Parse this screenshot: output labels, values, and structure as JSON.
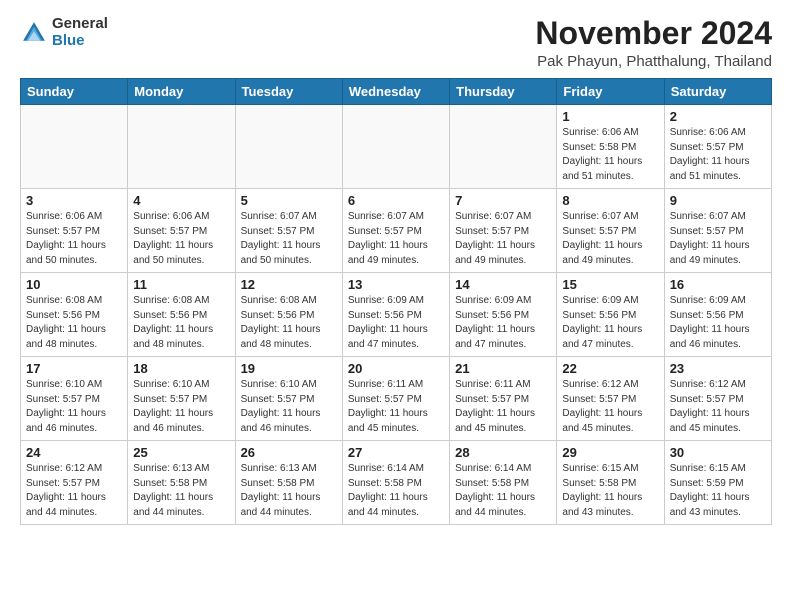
{
  "logo": {
    "general": "General",
    "blue": "Blue"
  },
  "title": "November 2024",
  "location": "Pak Phayun, Phatthalung, Thailand",
  "weekdays": [
    "Sunday",
    "Monday",
    "Tuesday",
    "Wednesday",
    "Thursday",
    "Friday",
    "Saturday"
  ],
  "weeks": [
    [
      {
        "day": "",
        "info": ""
      },
      {
        "day": "",
        "info": ""
      },
      {
        "day": "",
        "info": ""
      },
      {
        "day": "",
        "info": ""
      },
      {
        "day": "",
        "info": ""
      },
      {
        "day": "1",
        "info": "Sunrise: 6:06 AM\nSunset: 5:58 PM\nDaylight: 11 hours\nand 51 minutes."
      },
      {
        "day": "2",
        "info": "Sunrise: 6:06 AM\nSunset: 5:57 PM\nDaylight: 11 hours\nand 51 minutes."
      }
    ],
    [
      {
        "day": "3",
        "info": "Sunrise: 6:06 AM\nSunset: 5:57 PM\nDaylight: 11 hours\nand 50 minutes."
      },
      {
        "day": "4",
        "info": "Sunrise: 6:06 AM\nSunset: 5:57 PM\nDaylight: 11 hours\nand 50 minutes."
      },
      {
        "day": "5",
        "info": "Sunrise: 6:07 AM\nSunset: 5:57 PM\nDaylight: 11 hours\nand 50 minutes."
      },
      {
        "day": "6",
        "info": "Sunrise: 6:07 AM\nSunset: 5:57 PM\nDaylight: 11 hours\nand 49 minutes."
      },
      {
        "day": "7",
        "info": "Sunrise: 6:07 AM\nSunset: 5:57 PM\nDaylight: 11 hours\nand 49 minutes."
      },
      {
        "day": "8",
        "info": "Sunrise: 6:07 AM\nSunset: 5:57 PM\nDaylight: 11 hours\nand 49 minutes."
      },
      {
        "day": "9",
        "info": "Sunrise: 6:07 AM\nSunset: 5:57 PM\nDaylight: 11 hours\nand 49 minutes."
      }
    ],
    [
      {
        "day": "10",
        "info": "Sunrise: 6:08 AM\nSunset: 5:56 PM\nDaylight: 11 hours\nand 48 minutes."
      },
      {
        "day": "11",
        "info": "Sunrise: 6:08 AM\nSunset: 5:56 PM\nDaylight: 11 hours\nand 48 minutes."
      },
      {
        "day": "12",
        "info": "Sunrise: 6:08 AM\nSunset: 5:56 PM\nDaylight: 11 hours\nand 48 minutes."
      },
      {
        "day": "13",
        "info": "Sunrise: 6:09 AM\nSunset: 5:56 PM\nDaylight: 11 hours\nand 47 minutes."
      },
      {
        "day": "14",
        "info": "Sunrise: 6:09 AM\nSunset: 5:56 PM\nDaylight: 11 hours\nand 47 minutes."
      },
      {
        "day": "15",
        "info": "Sunrise: 6:09 AM\nSunset: 5:56 PM\nDaylight: 11 hours\nand 47 minutes."
      },
      {
        "day": "16",
        "info": "Sunrise: 6:09 AM\nSunset: 5:56 PM\nDaylight: 11 hours\nand 46 minutes."
      }
    ],
    [
      {
        "day": "17",
        "info": "Sunrise: 6:10 AM\nSunset: 5:57 PM\nDaylight: 11 hours\nand 46 minutes."
      },
      {
        "day": "18",
        "info": "Sunrise: 6:10 AM\nSunset: 5:57 PM\nDaylight: 11 hours\nand 46 minutes."
      },
      {
        "day": "19",
        "info": "Sunrise: 6:10 AM\nSunset: 5:57 PM\nDaylight: 11 hours\nand 46 minutes."
      },
      {
        "day": "20",
        "info": "Sunrise: 6:11 AM\nSunset: 5:57 PM\nDaylight: 11 hours\nand 45 minutes."
      },
      {
        "day": "21",
        "info": "Sunrise: 6:11 AM\nSunset: 5:57 PM\nDaylight: 11 hours\nand 45 minutes."
      },
      {
        "day": "22",
        "info": "Sunrise: 6:12 AM\nSunset: 5:57 PM\nDaylight: 11 hours\nand 45 minutes."
      },
      {
        "day": "23",
        "info": "Sunrise: 6:12 AM\nSunset: 5:57 PM\nDaylight: 11 hours\nand 45 minutes."
      }
    ],
    [
      {
        "day": "24",
        "info": "Sunrise: 6:12 AM\nSunset: 5:57 PM\nDaylight: 11 hours\nand 44 minutes."
      },
      {
        "day": "25",
        "info": "Sunrise: 6:13 AM\nSunset: 5:58 PM\nDaylight: 11 hours\nand 44 minutes."
      },
      {
        "day": "26",
        "info": "Sunrise: 6:13 AM\nSunset: 5:58 PM\nDaylight: 11 hours\nand 44 minutes."
      },
      {
        "day": "27",
        "info": "Sunrise: 6:14 AM\nSunset: 5:58 PM\nDaylight: 11 hours\nand 44 minutes."
      },
      {
        "day": "28",
        "info": "Sunrise: 6:14 AM\nSunset: 5:58 PM\nDaylight: 11 hours\nand 44 minutes."
      },
      {
        "day": "29",
        "info": "Sunrise: 6:15 AM\nSunset: 5:58 PM\nDaylight: 11 hours\nand 43 minutes."
      },
      {
        "day": "30",
        "info": "Sunrise: 6:15 AM\nSunset: 5:59 PM\nDaylight: 11 hours\nand 43 minutes."
      }
    ]
  ]
}
